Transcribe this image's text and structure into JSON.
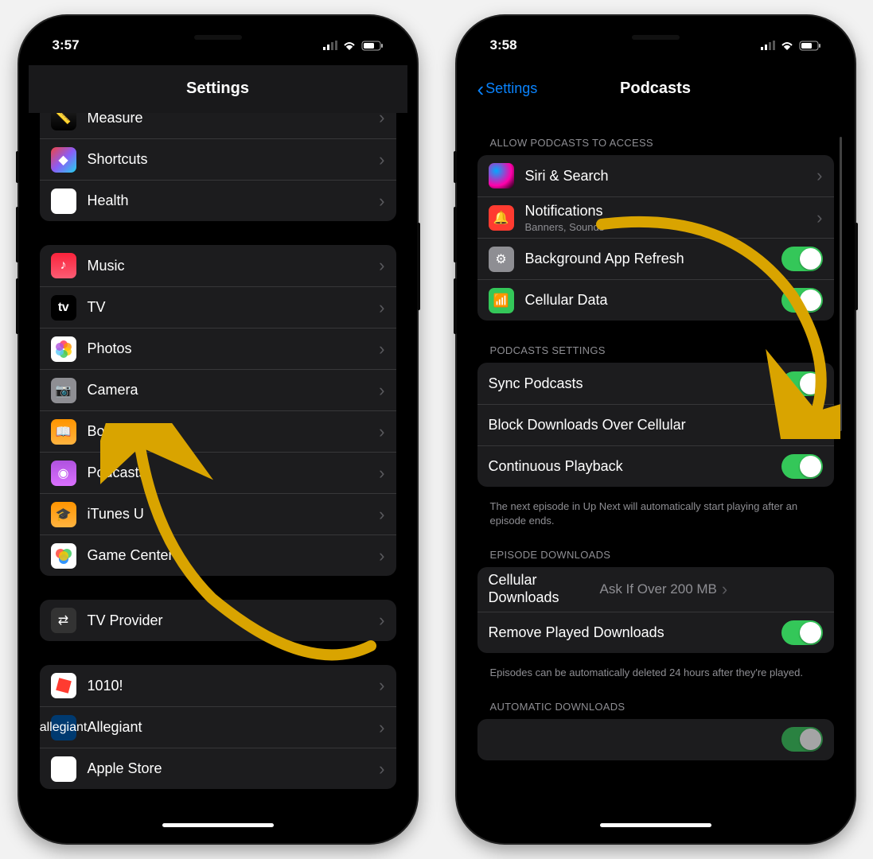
{
  "left": {
    "time": "3:57",
    "title": "Settings",
    "groups": [
      {
        "rows": [
          {
            "icon": "measure",
            "label": "Measure"
          },
          {
            "icon": "shortcuts",
            "label": "Shortcuts"
          },
          {
            "icon": "health",
            "label": "Health"
          }
        ]
      },
      {
        "rows": [
          {
            "icon": "music",
            "label": "Music"
          },
          {
            "icon": "tv",
            "label": "TV"
          },
          {
            "icon": "photos",
            "label": "Photos"
          },
          {
            "icon": "camera",
            "label": "Camera"
          },
          {
            "icon": "books",
            "label": "Books"
          },
          {
            "icon": "podcasts",
            "label": "Podcasts"
          },
          {
            "icon": "itunesu",
            "label": "iTunes U"
          },
          {
            "icon": "gamecenter",
            "label": "Game Center"
          }
        ]
      },
      {
        "rows": [
          {
            "icon": "tvprovider",
            "label": "TV Provider"
          }
        ]
      },
      {
        "rows": [
          {
            "icon": "1010",
            "label": "1010!"
          },
          {
            "icon": "allegiant",
            "label": "Allegiant"
          },
          {
            "icon": "applestore",
            "label": "Apple Store"
          }
        ]
      }
    ]
  },
  "right": {
    "time": "3:58",
    "back": "Settings",
    "title": "Podcasts",
    "sections": {
      "access_header": "ALLOW PODCASTS TO ACCESS",
      "access_rows": {
        "siri": "Siri & Search",
        "notif": "Notifications",
        "notif_sub": "Banners, Sounds",
        "bgrefresh": "Background App Refresh",
        "cellular": "Cellular Data"
      },
      "settings_header": "PODCASTS SETTINGS",
      "settings_rows": {
        "sync": "Sync Podcasts",
        "block": "Block Downloads Over Cellular",
        "continuous": "Continuous Playback"
      },
      "settings_footer": "The next episode in Up Next will automatically start playing after an episode ends.",
      "downloads_header": "EPISODE DOWNLOADS",
      "downloads_rows": {
        "cellular_label": "Cellular Downloads",
        "cellular_value": "Ask If Over 200 MB",
        "remove": "Remove Played Downloads"
      },
      "downloads_footer": "Episodes can be automatically deleted 24 hours after they're played.",
      "auto_header": "AUTOMATIC DOWNLOADS"
    }
  }
}
